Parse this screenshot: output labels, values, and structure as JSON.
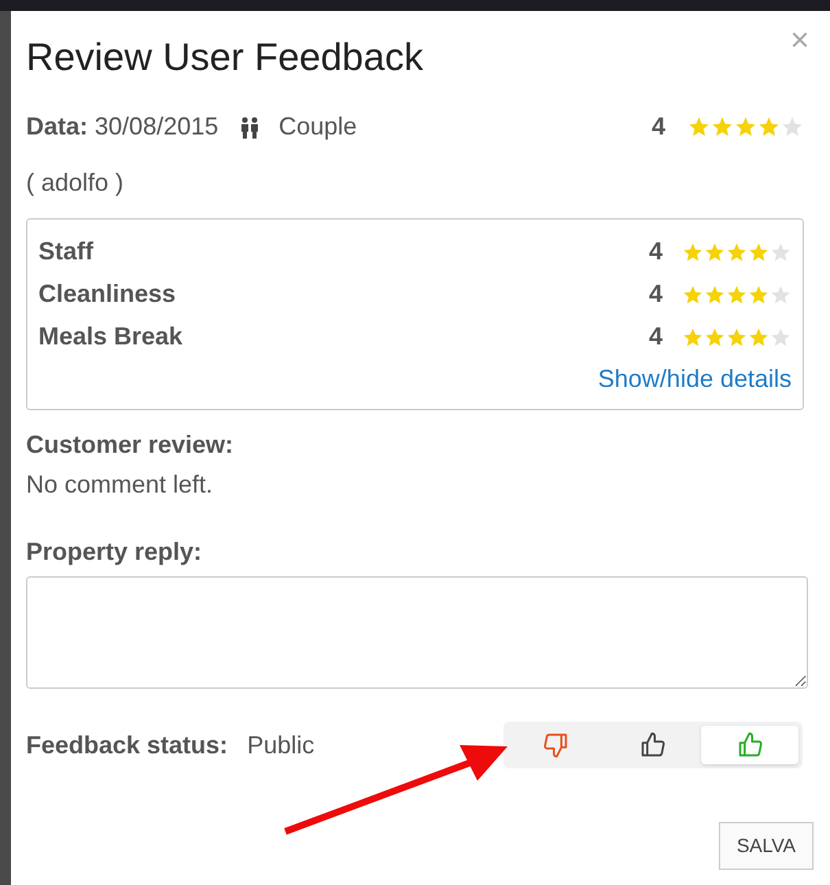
{
  "dialog": {
    "title": "Review User Feedback",
    "close": "×"
  },
  "summary": {
    "date_label": "Data:",
    "date": "30/08/2015",
    "guest_type": "Couple",
    "score": "4",
    "stars": 4
  },
  "reviewer": "( adolfo )",
  "ratings": [
    {
      "name": "Staff",
      "score": "4",
      "stars": 4
    },
    {
      "name": "Cleanliness",
      "score": "4",
      "stars": 4
    },
    {
      "name": "Meals Break",
      "score": "4",
      "stars": 4
    }
  ],
  "details_link": "Show/hide details",
  "customer_review": {
    "label": "Customer review:",
    "text": "No comment left."
  },
  "property_reply": {
    "label": "Property reply:"
  },
  "feedback_status": {
    "label": "Feedback status:",
    "value": "Public",
    "options": [
      {
        "kind": "dislike",
        "selected": false
      },
      {
        "kind": "neutral",
        "selected": false
      },
      {
        "kind": "like",
        "selected": true
      }
    ]
  },
  "save_button": "SALVA"
}
